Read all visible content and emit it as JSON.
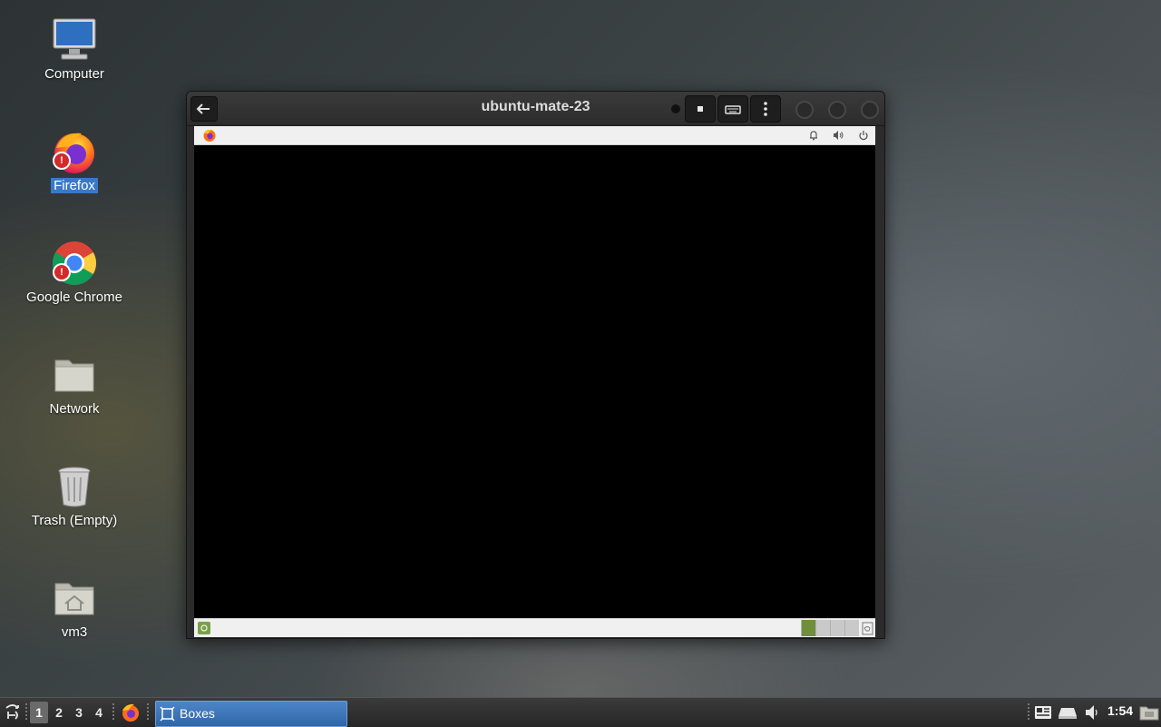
{
  "desktop": {
    "icons": [
      {
        "label": "Computer",
        "icon": "computer-icon"
      },
      {
        "label": "Firefox",
        "icon": "firefox-icon",
        "selected": true,
        "badge": "!"
      },
      {
        "label": "Google Chrome",
        "icon": "chrome-icon",
        "badge": "!"
      },
      {
        "label": "Network",
        "icon": "folder-icon"
      },
      {
        "label": "Trash (Empty)",
        "icon": "trash-icon"
      },
      {
        "label": "vm3",
        "icon": "home-folder-icon"
      }
    ]
  },
  "window": {
    "title": "ubuntu-mate-23",
    "buttons": [
      "back-icon",
      "stop-icon",
      "keyboard-icon",
      "menu-dots-icon",
      "minimize-icon",
      "maximize-icon",
      "close-icon"
    ]
  },
  "guest": {
    "top_panel_icons": [
      "firefox-icon",
      "bell-icon",
      "volume-icon",
      "power-icon"
    ],
    "bottom_panel_icons": [
      "show-desktop-icon",
      "trash-icon"
    ],
    "workspaces": 4,
    "active_workspace_color": "#6f8f3d"
  },
  "taskbar": {
    "workspaces": [
      "1",
      "2",
      "3",
      "4"
    ],
    "active_workspace": "1",
    "task_label": "Boxes",
    "clock": "1:54",
    "tray_icons": [
      "keyboard-layout-icon",
      "network-icon",
      "volume-icon",
      "file-manager-icon"
    ]
  },
  "colors": {
    "selection": "#3a78c9",
    "task_active": "#3b74b8"
  }
}
